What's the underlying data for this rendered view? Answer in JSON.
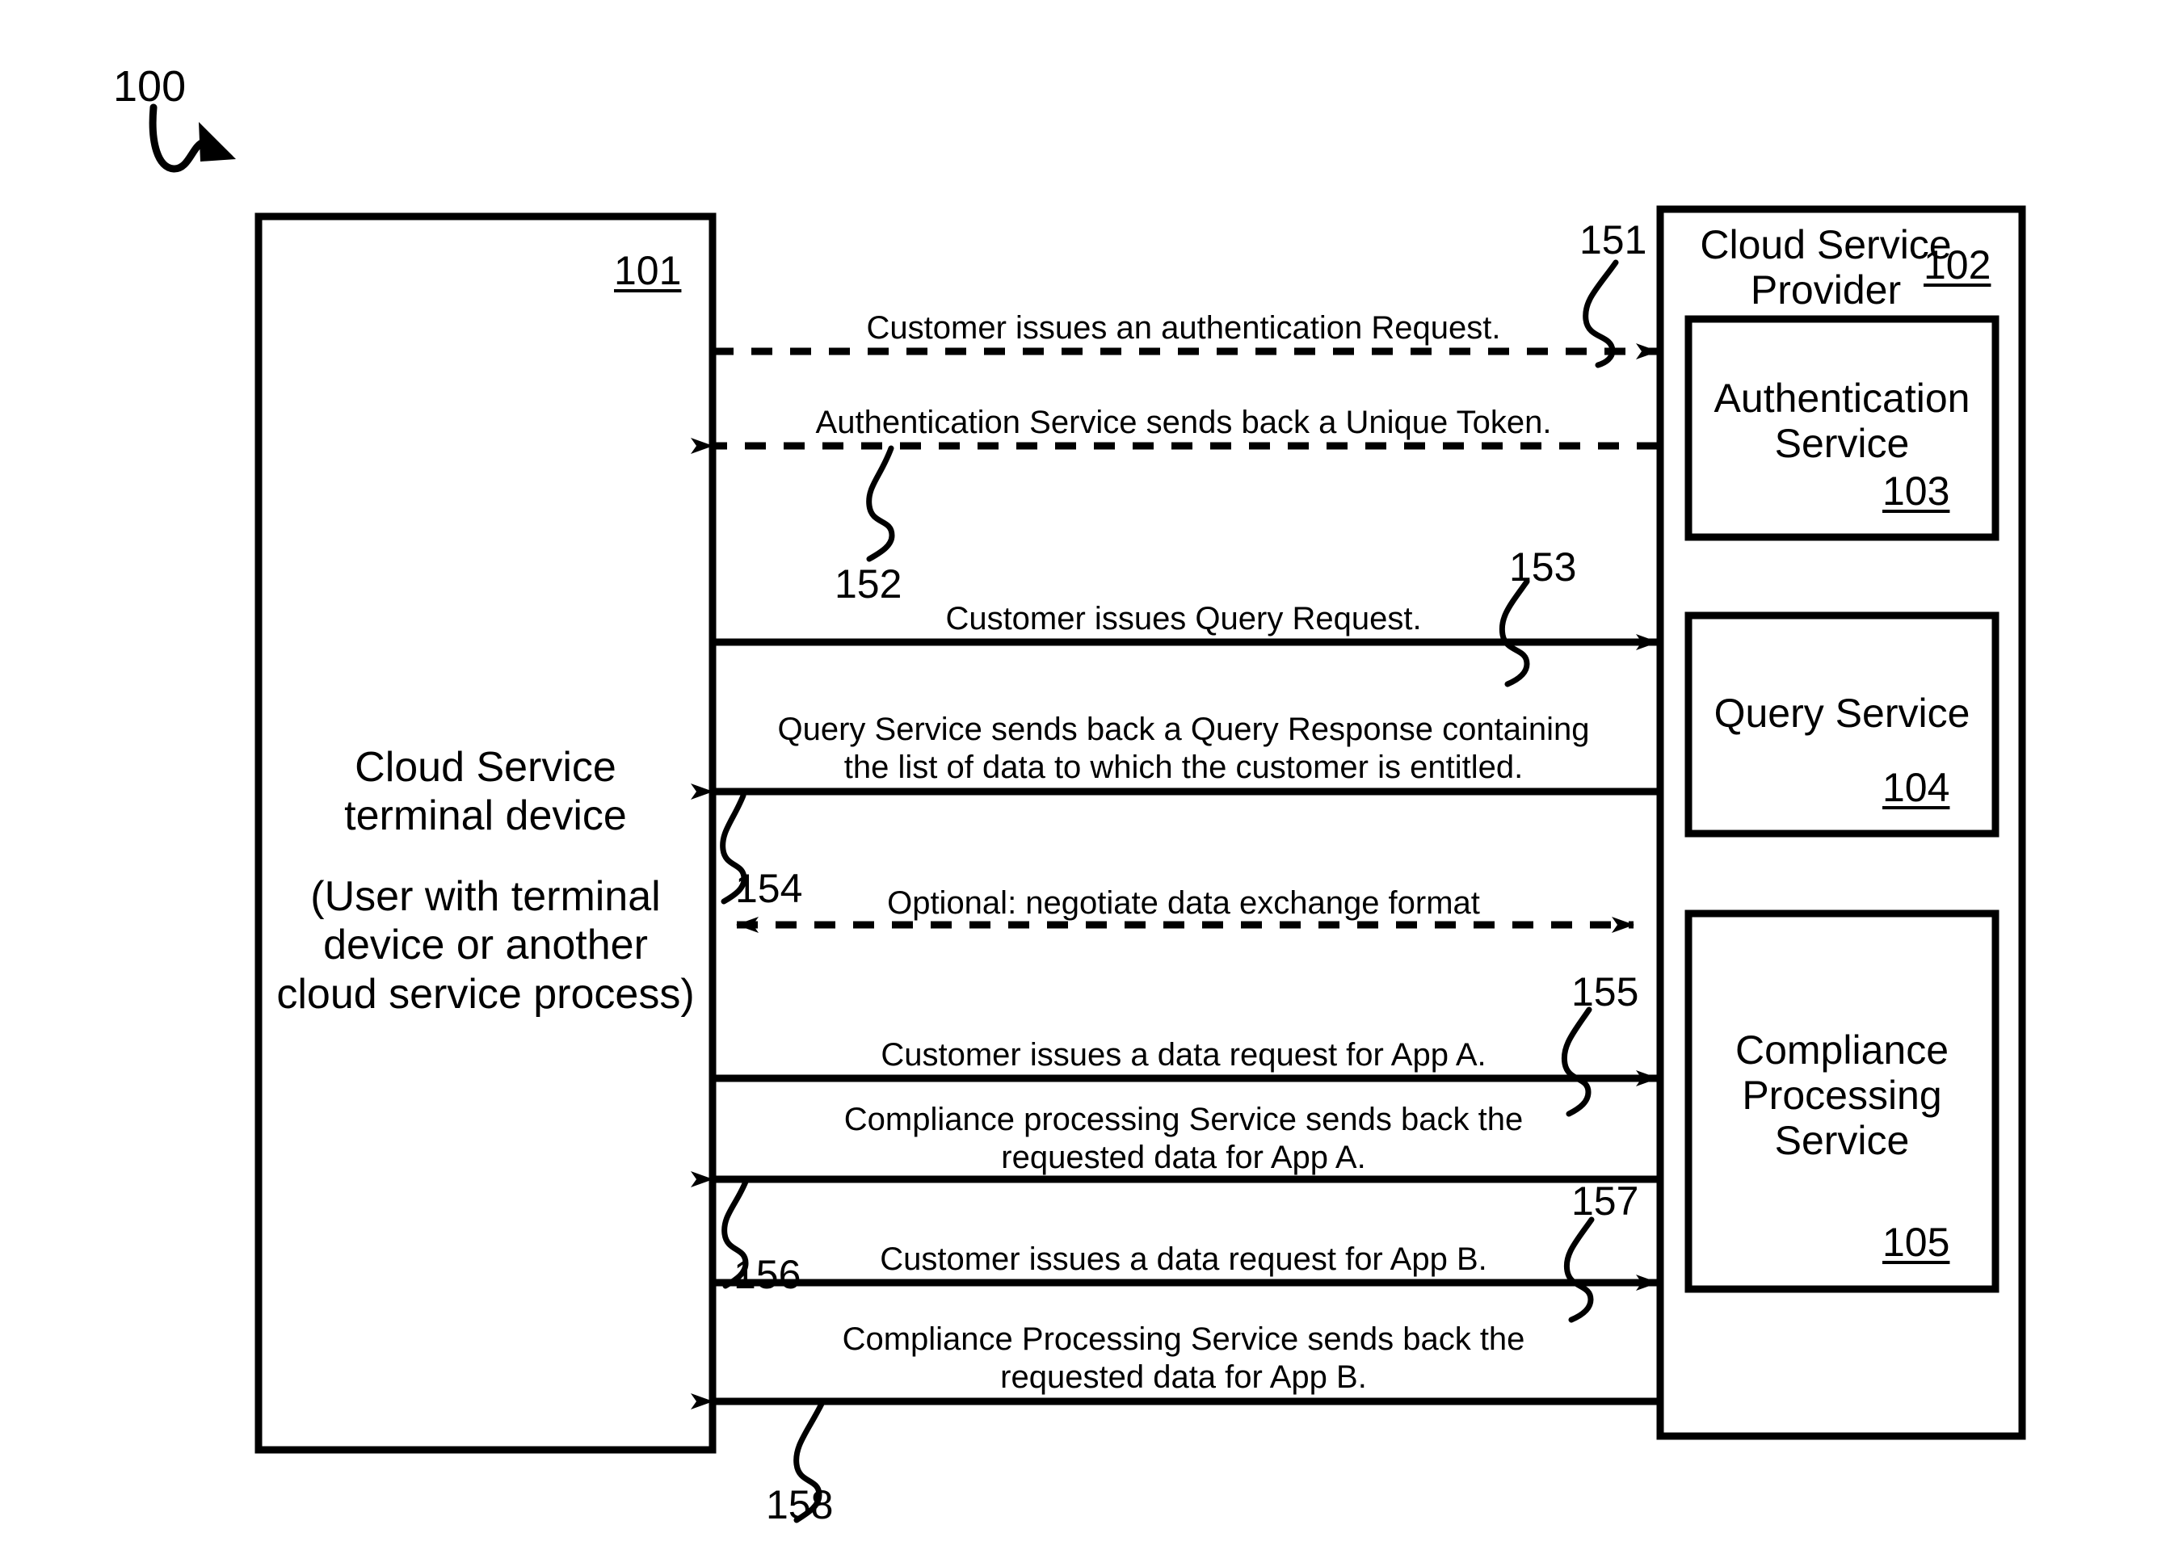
{
  "figure": {
    "number": "100",
    "lead_icon": "squiggly-lead-arrow-icon"
  },
  "terminal_box": {
    "ref": "101",
    "title": "Cloud Service\nterminal device",
    "subtitle": "(User with terminal\ndevice or another\ncloud service process)"
  },
  "provider_box": {
    "ref": "102",
    "title": "Cloud Service\nProvider",
    "services": [
      {
        "ref": "103",
        "label": "Authentication\nService"
      },
      {
        "ref": "104",
        "label": "Query Service"
      },
      {
        "ref": "105",
        "label": "Compliance\nProcessing\nService"
      }
    ]
  },
  "messages": [
    {
      "ref": "151",
      "text": "Customer issues an authentication Request.",
      "direction": "right",
      "style": "dashed"
    },
    {
      "ref": "152",
      "text": "Authentication Service sends back a Unique Token.",
      "direction": "left",
      "style": "dashed"
    },
    {
      "ref": "153",
      "text": "Customer issues Query Request.",
      "direction": "right",
      "style": "solid"
    },
    {
      "ref": "154",
      "text": "Query Service sends back a Query Response containing\nthe list of data to which the customer is entitled.",
      "direction": "left",
      "style": "solid"
    },
    {
      "ref": "",
      "text": "Optional: negotiate data exchange format",
      "direction": "both",
      "style": "dashed"
    },
    {
      "ref": "155",
      "text": "Customer issues a data request for App A.",
      "direction": "right",
      "style": "solid"
    },
    {
      "ref": "156",
      "text": "Compliance processing Service sends back the\nrequested data for App A.",
      "direction": "left",
      "style": "solid"
    },
    {
      "ref": "157",
      "text": "Customer issues a data request for App B.",
      "direction": "right",
      "style": "solid"
    },
    {
      "ref": "158",
      "text": "Compliance Processing Service sends back the\nrequested data for App B.",
      "direction": "left",
      "style": "solid"
    }
  ],
  "colors": {
    "ink": "#000000",
    "paper": "#ffffff"
  }
}
